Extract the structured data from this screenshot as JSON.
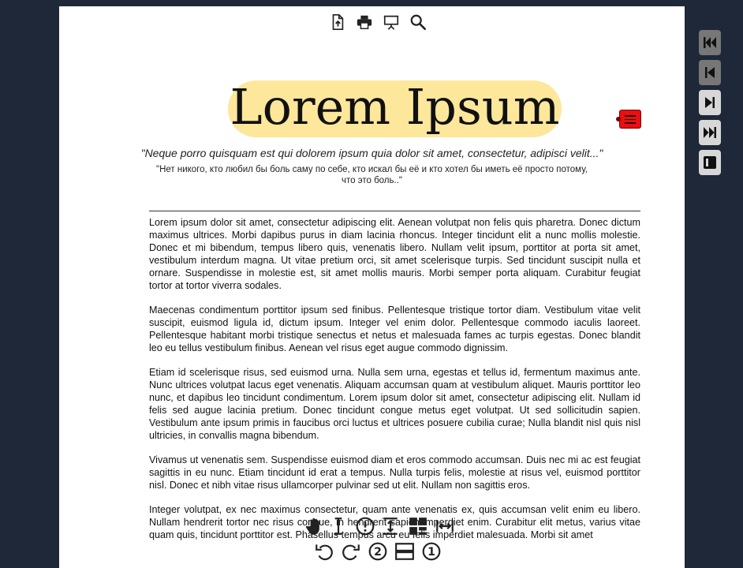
{
  "toolbar_top": {
    "icons": [
      "upload-icon",
      "print-icon",
      "presentation-icon",
      "search-icon"
    ]
  },
  "document": {
    "title": "Lorem Ipsum",
    "quote_latin": "\"Neque porro quisquam est qui dolorem ipsum quia dolor sit amet, consectetur, adipisci velit...\"",
    "quote_russian": "\"Нет никого, кто любил бы боль саму по себе, кто искал бы её и кто хотел бы иметь её просто потому, что это боль..\"",
    "paragraphs": [
      "Lorem ipsum dolor sit amet, consectetur adipiscing elit. Aenean volutpat non felis quis pharetra. Donec dictum maximus ultrices. Morbi dapibus purus in diam lacinia rhoncus. Integer tincidunt elit a nunc mollis molestie. Donec et mi bibendum, tempus libero quis, venenatis libero. Nullam velit ipsum, porttitor at porta sit amet, vestibulum interdum magna. Ut vitae pretium orci, sit amet scelerisque turpis. Sed tincidunt suscipit nulla et ornare. Suspendisse in molestie est, sit amet mollis mauris. Morbi semper porta aliquam. Curabitur feugiat tortor at tortor viverra sodales.",
      "Maecenas condimentum porttitor ipsum sed finibus. Pellentesque tristique tortor diam. Vestibulum vitae velit suscipit, euismod ligula id, dictum ipsum. Integer vel enim dolor. Pellentesque commodo iaculis laoreet. Pellentesque habitant morbi tristique senectus et netus et malesuada fames ac turpis egestas. Donec blandit leo eu tellus vestibulum finibus. Aenean vel risus eget augue commodo dignissim.",
      "Etiam id scelerisque risus, sed euismod urna. Nulla sem urna, egestas et tellus id, fermentum maximus ante. Nunc ultrices volutpat lacus eget venenatis. Aliquam accumsan quam at vestibulum aliquet. Mauris porttitor leo nunc, et dapibus leo tincidunt condimentum. Lorem ipsum dolor sit amet, consectetur adipiscing elit. Nullam id felis sed augue lacinia pretium. Donec tincidunt congue metus eget volutpat. Ut sed sollicitudin sapien. Vestibulum ante ipsum primis in faucibus orci luctus et ultrices posuere cubilia curae; Nulla blandit nisl quis nisl ultricies, in convallis magna bibendum.",
      "Vivamus ut venenatis sem. Suspendisse euismod diam et eros commodo accumsan. Duis nec mi ac est feugiat sagittis in eu nunc. Etiam tincidunt id erat a tempus. Nulla turpis felis, molestie at risus vel, euismod porttitor nisl. Donec et nibh vitae risus ullamcorper pulvinar sed ut elit. Nullam non sagittis eros.",
      "Integer volutpat, ex nec maximus consectetur, quam ante venenatis ex, quis accumsan velit enim eu libero. Nullam hendrerit tortor nec risus congue, in hendrerit sapien imperdiet enim. Curabitur elit metus, varius vitae quam quis, tincidunt porttitor est. Phasellus tempus arcu eu felis imperdiet malesuada. Morbi sit amet"
    ]
  },
  "toolbar_bottom": {
    "icons": [
      "hand-tool-icon",
      "text-select-icon",
      "annotation-icon",
      "fit-height-icon",
      "thumbnails-icon",
      "fit-width-icon",
      "rotate-left-icon",
      "rotate-right-icon",
      "two-page-icon",
      "scroll-mode-icon",
      "single-page-icon"
    ],
    "two_page_label": "2",
    "single_page_label": "1"
  },
  "side_nav": {
    "buttons": [
      "first-page-icon",
      "previous-page-icon",
      "next-page-icon",
      "last-page-icon",
      "sidebar-toggle-icon"
    ]
  },
  "colors": {
    "background": "#1f2838",
    "title_highlight": "#fde79b",
    "bookmark": "#e81010",
    "disabled_button": "#777777",
    "enabled_button": "#d7d7d7"
  }
}
